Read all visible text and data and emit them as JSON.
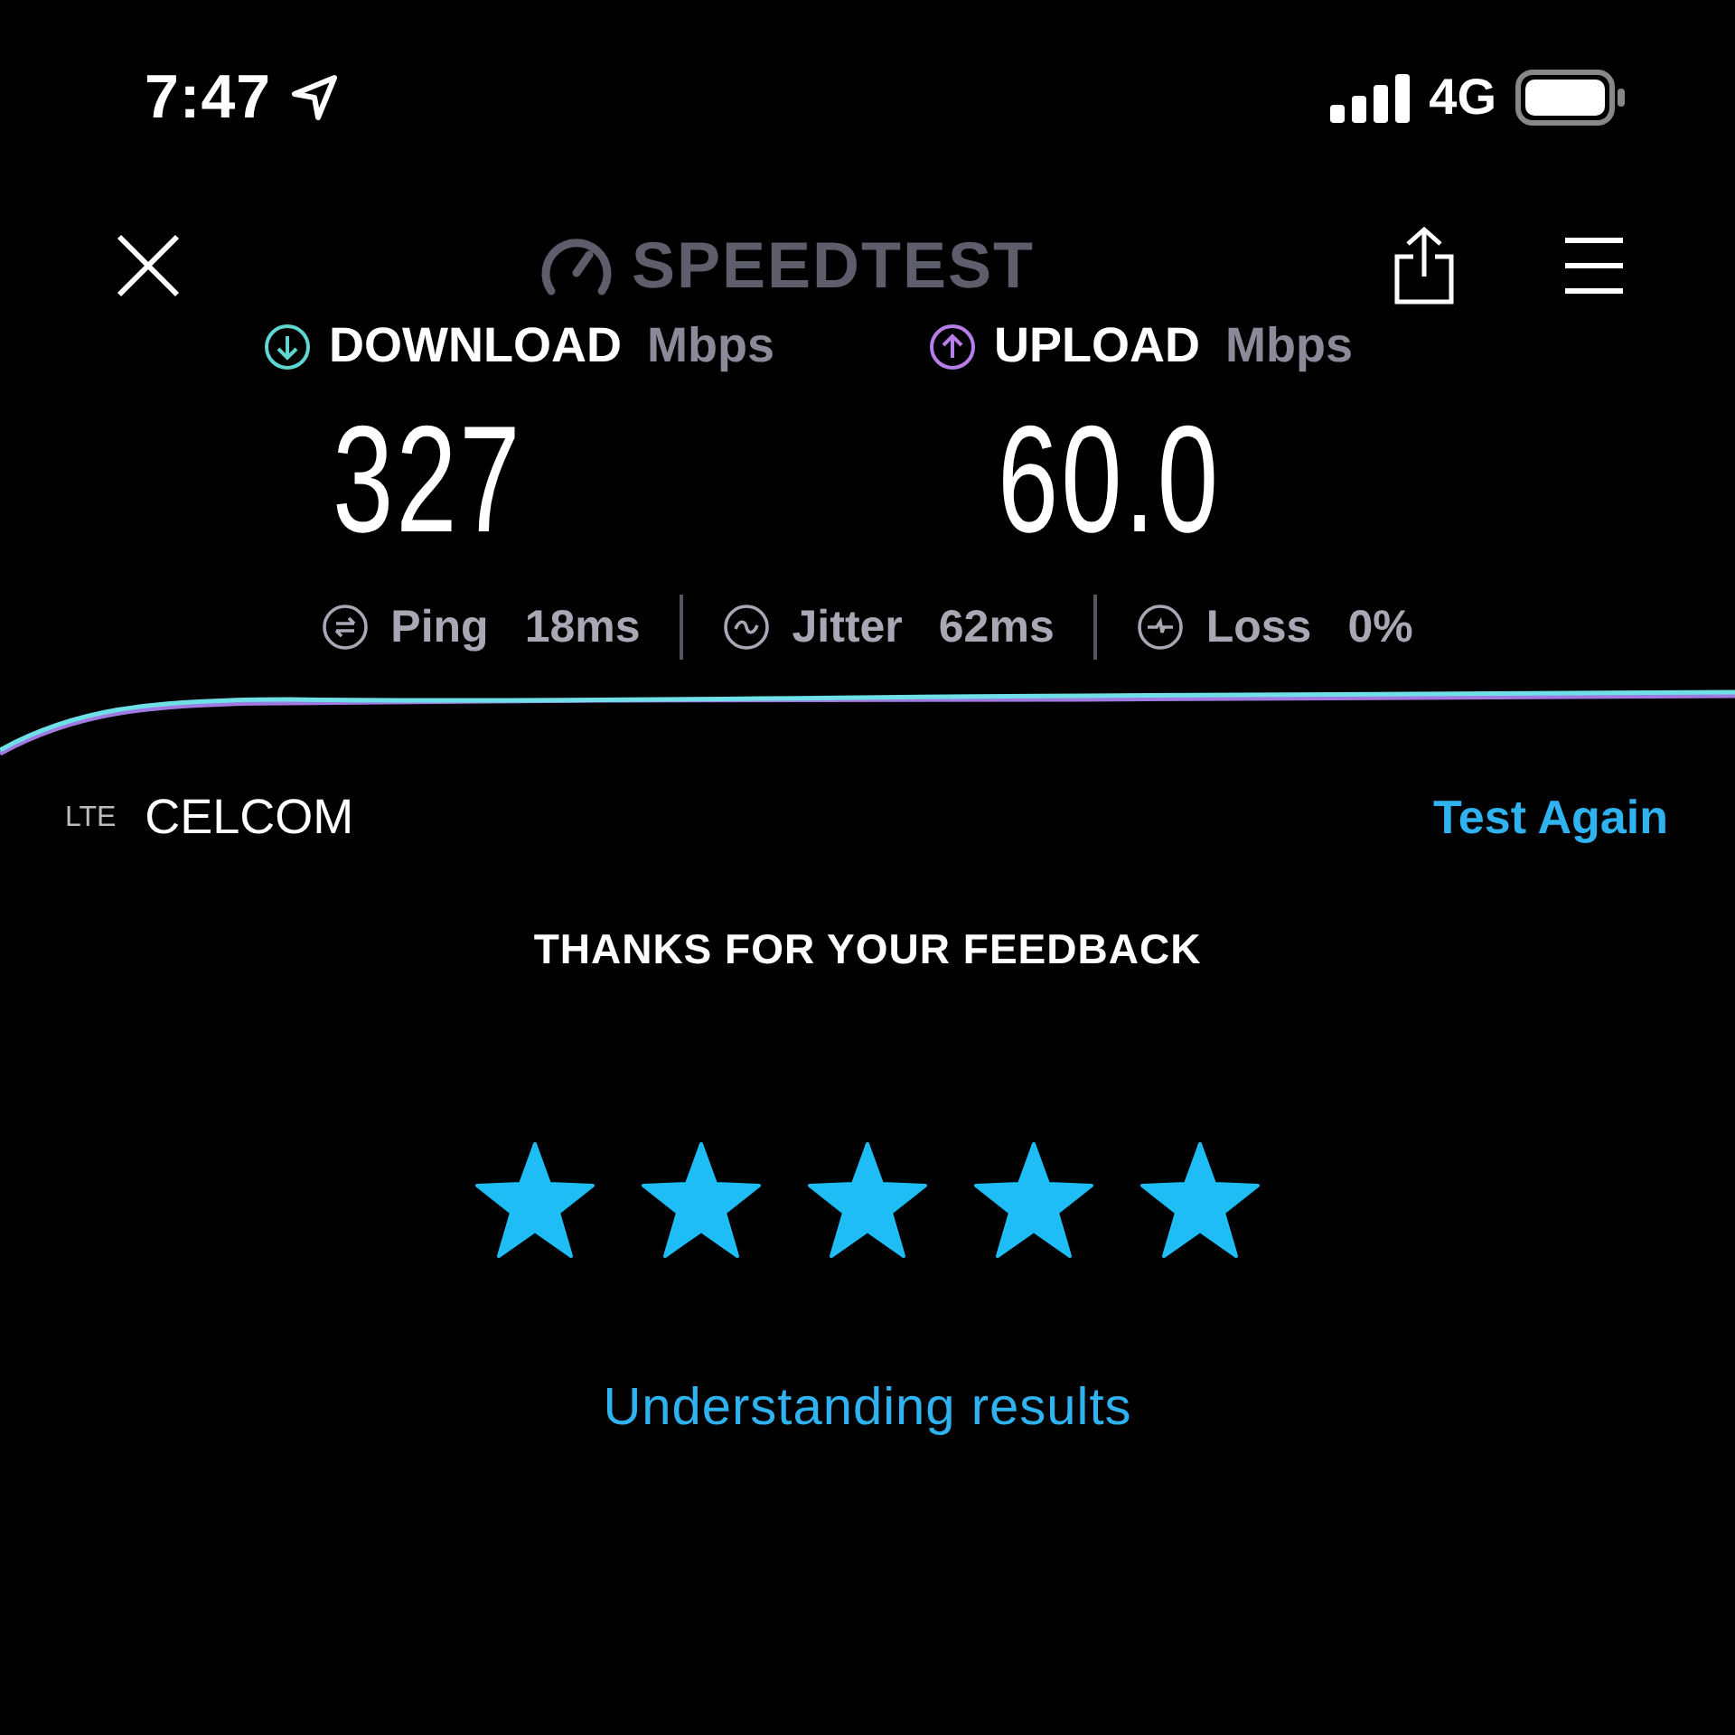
{
  "status_bar": {
    "time": "7:47",
    "network": "4G"
  },
  "header": {
    "brand": "SPEEDTEST"
  },
  "results": [
    {
      "kind": "download",
      "label": "DOWNLOAD",
      "unit": "Mbps",
      "value": "327",
      "color": "#5fd6d0"
    },
    {
      "kind": "upload",
      "label": "UPLOAD",
      "unit": "Mbps",
      "value": "60.0",
      "color": "#b57ee8"
    }
  ],
  "metrics": [
    {
      "kind": "ping",
      "label": "Ping",
      "value": "18",
      "unit": "ms"
    },
    {
      "kind": "jitter",
      "label": "Jitter",
      "value": "62",
      "unit": "ms"
    },
    {
      "kind": "loss",
      "label": "Loss",
      "value": "0",
      "unit": "%"
    }
  ],
  "connection": {
    "type": "LTE",
    "carrier": "CELCOM",
    "action": "Test Again"
  },
  "feedback": {
    "title": "THANKS FOR YOUR FEEDBACK",
    "stars": 5,
    "link": "Understanding results"
  }
}
